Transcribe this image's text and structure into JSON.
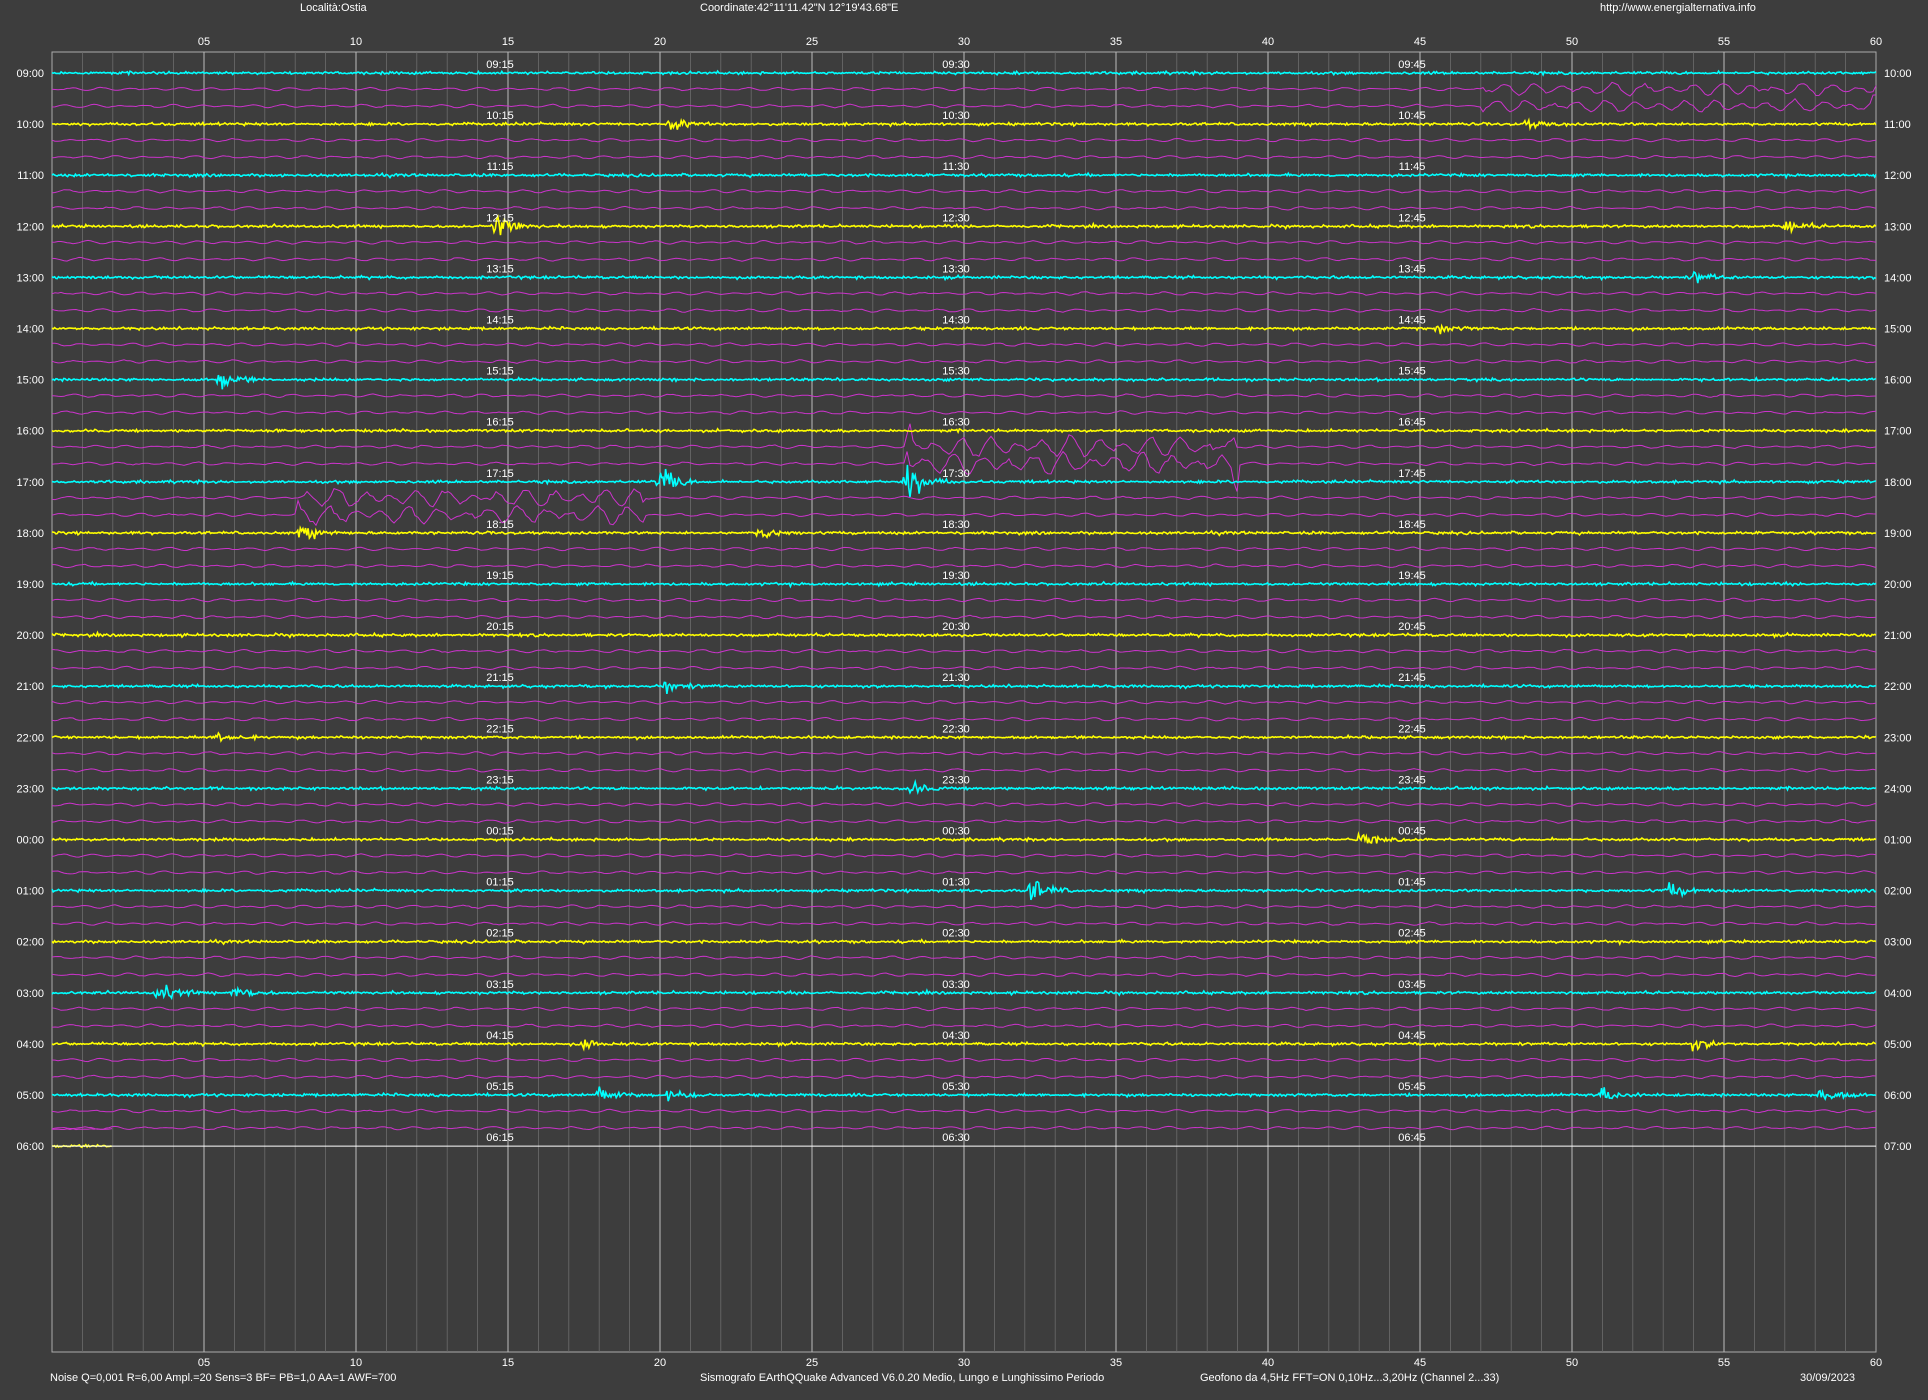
{
  "header": {
    "location": "Località:Ostia",
    "coordinates": "Coordinate:42°11'11.42\"N  12°19'43.68\"E",
    "website": "http://www.energialternativa.info"
  },
  "footer": {
    "parameters": "Noise Q=0,001 R=6,00 Ampl.=20 Sens=3 BF= PB=1,0 AA=1 AWF=700",
    "software": "Sismografo  EArthQQuake Advanced V6.0.20  Medio, Lungo e Lunghissimo Periodo",
    "sensor": "Geofono da 4,5Hz FFT=ON 0,10Hz...3,20Hz     (Channel 2...33)",
    "date": "30/09/2023"
  },
  "colors": {
    "background": "#3d3d3d",
    "trace_odd": "#00ffff",
    "trace_even": "#ffff00",
    "long_period": "#cc33cc",
    "grid": "#aaaaaa",
    "text": "#ffffff"
  },
  "chart_data": {
    "type": "line",
    "subtype": "helicorder",
    "x_axis_minutes": [
      "05",
      "10",
      "15",
      "20",
      "25",
      "30",
      "35",
      "40",
      "45",
      "50",
      "55",
      "60"
    ],
    "x_range_minutes": [
      0,
      60
    ],
    "grid_minutes_step": 1,
    "grid": true,
    "row_labels_left": [
      "09:00",
      "10:00",
      "11:00",
      "12:00",
      "13:00",
      "14:00",
      "15:00",
      "16:00",
      "17:00",
      "18:00",
      "19:00",
      "20:00",
      "21:00",
      "22:00",
      "23:00",
      "00:00",
      "01:00",
      "02:00",
      "03:00",
      "04:00",
      "05:00",
      "06:00"
    ],
    "row_labels_right": [
      "10:00",
      "11:00",
      "12:00",
      "13:00",
      "14:00",
      "15:00",
      "16:00",
      "17:00",
      "18:00",
      "19:00",
      "20:00",
      "21:00",
      "22:00",
      "23:00",
      "24:00",
      "01:00",
      "02:00",
      "03:00",
      "04:00",
      "05:00",
      "06:00",
      "07:00"
    ],
    "quarter_labels": [
      [
        "09:15",
        "09:30",
        "09:45"
      ],
      [
        "10:15",
        "10:30",
        "10:45"
      ],
      [
        "11:15",
        "11:30",
        "11:45"
      ],
      [
        "12:15",
        "12:30",
        "12:45"
      ],
      [
        "13:15",
        "13:30",
        "13:45"
      ],
      [
        "14:15",
        "14:30",
        "14:45"
      ],
      [
        "15:15",
        "15:30",
        "15:45"
      ],
      [
        "16:15",
        "16:30",
        "16:45"
      ],
      [
        "17:15",
        "17:30",
        "17:45"
      ],
      [
        "18:15",
        "18:30",
        "18:45"
      ],
      [
        "19:15",
        "19:30",
        "19:45"
      ],
      [
        "20:15",
        "20:30",
        "20:45"
      ],
      [
        "21:15",
        "21:30",
        "21:45"
      ],
      [
        "22:15",
        "22:30",
        "22:45"
      ],
      [
        "23:15",
        "23:30",
        "23:45"
      ],
      [
        "00:15",
        "00:30",
        "00:45"
      ],
      [
        "01:15",
        "01:30",
        "01:45"
      ],
      [
        "02:15",
        "02:30",
        "02:45"
      ],
      [
        "03:15",
        "03:30",
        "03:45"
      ],
      [
        "04:15",
        "04:30",
        "04:45"
      ],
      [
        "05:15",
        "05:30",
        "05:45"
      ],
      [
        "06:15",
        "06:30",
        "06:45"
      ]
    ],
    "recording_end_minute_last_row": 2,
    "events": [
      {
        "row": 1,
        "minute": 20.3,
        "amplitude": 0.5
      },
      {
        "row": 1,
        "minute": 48.5,
        "amplitude": 0.4
      },
      {
        "row": 3,
        "minute": 14.6,
        "amplitude": 1.0
      },
      {
        "row": 3,
        "minute": 57.0,
        "amplitude": 0.6
      },
      {
        "row": 4,
        "minute": 54.0,
        "amplitude": 0.45
      },
      {
        "row": 5,
        "minute": 45.5,
        "amplitude": 0.35
      },
      {
        "row": 6,
        "minute": 5.5,
        "amplitude": 0.8
      },
      {
        "row": 8,
        "minute": 20.0,
        "amplitude": 1.2
      },
      {
        "row": 8,
        "minute": 28.1,
        "amplitude": 1.8
      },
      {
        "row": 9,
        "minute": 8.2,
        "amplitude": 0.6
      },
      {
        "row": 9,
        "minute": 23.3,
        "amplitude": 0.5
      },
      {
        "row": 12,
        "minute": 20.2,
        "amplitude": 0.5
      },
      {
        "row": 13,
        "minute": 5.5,
        "amplitude": 0.5
      },
      {
        "row": 14,
        "minute": 28.2,
        "amplitude": 0.5
      },
      {
        "row": 15,
        "minute": 43.0,
        "amplitude": 0.5
      },
      {
        "row": 16,
        "minute": 32.2,
        "amplitude": 1.1
      },
      {
        "row": 16,
        "minute": 53.2,
        "amplitude": 0.7
      },
      {
        "row": 18,
        "minute": 3.5,
        "amplitude": 0.9
      },
      {
        "row": 18,
        "minute": 6.0,
        "amplitude": 0.6
      },
      {
        "row": 19,
        "minute": 17.5,
        "amplitude": 0.4
      },
      {
        "row": 19,
        "minute": 54.0,
        "amplitude": 0.5
      },
      {
        "row": 20,
        "minute": 18.0,
        "amplitude": 0.7
      },
      {
        "row": 20,
        "minute": 20.3,
        "amplitude": 0.6
      },
      {
        "row": 20,
        "minute": 51.0,
        "amplitude": 0.6
      },
      {
        "row": 20,
        "minute": 58.2,
        "amplitude": 0.9
      }
    ],
    "long_period_bursts": [
      {
        "row": 0,
        "start_minute": 47,
        "end_minute": 60,
        "amplitude": 0.5
      },
      {
        "row": 7,
        "start_minute": 28.1,
        "end_minute": 39.0,
        "amplitude": 1.0
      },
      {
        "row": 8,
        "start_minute": 8.0,
        "end_minute": 19.5,
        "amplitude": 0.8
      }
    ]
  }
}
